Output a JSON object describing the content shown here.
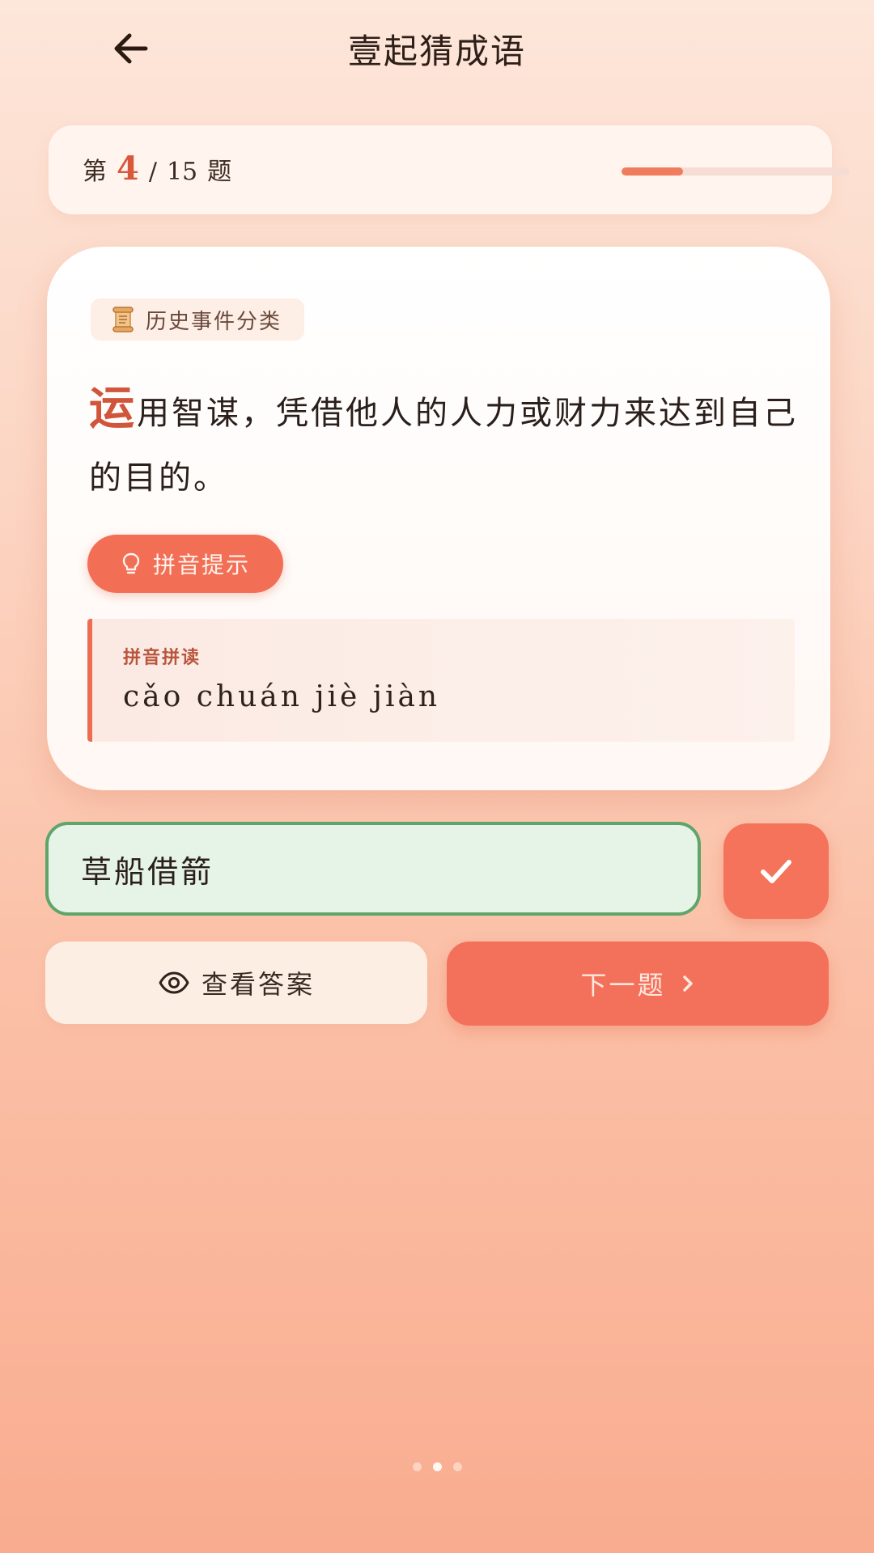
{
  "header": {
    "title": "壹起猜成语"
  },
  "progress": {
    "prefix": "第",
    "current": "4",
    "separator": "/",
    "total": "15",
    "suffix": "题",
    "fraction": 0.27
  },
  "question": {
    "category": "历史事件分类",
    "first_char": "运",
    "rest_text": "用智谋，凭借他人的人力或财力来达到自己的目的。",
    "hint_label": "拼音提示",
    "pinyin_title": "拼音拼读",
    "pinyin": "cǎo chuán jiè jiàn"
  },
  "answer": {
    "value": "草船借箭"
  },
  "actions": {
    "view_answer_label": "查看答案",
    "next_label": "下一题"
  },
  "pager": {
    "count": 3,
    "active": 1
  },
  "colors": {
    "accent": "#f3715a",
    "highlight": "#d0553a",
    "success_border": "#5fa46a",
    "success_bg": "#e6f4e8"
  }
}
